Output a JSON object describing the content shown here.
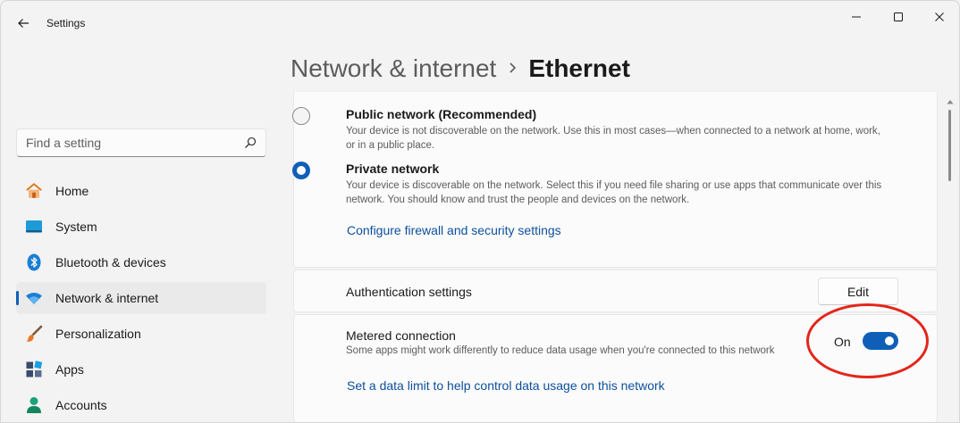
{
  "window": {
    "app_title": "Settings",
    "controls": {
      "minimize": "minimize-icon",
      "maximize": "maximize-icon",
      "close": "close-icon"
    }
  },
  "breadcrumb": {
    "parent": "Network & internet",
    "separator": "›",
    "current": "Ethernet"
  },
  "search": {
    "placeholder": "Find a setting"
  },
  "sidebar": {
    "items": [
      {
        "label": "Home",
        "icon": "home-icon",
        "active": false
      },
      {
        "label": "System",
        "icon": "system-icon",
        "active": false
      },
      {
        "label": "Bluetooth & devices",
        "icon": "bluetooth-icon",
        "active": false
      },
      {
        "label": "Network & internet",
        "icon": "wifi-icon",
        "active": true
      },
      {
        "label": "Personalization",
        "icon": "brush-icon",
        "active": false
      },
      {
        "label": "Apps",
        "icon": "apps-icon",
        "active": false
      },
      {
        "label": "Accounts",
        "icon": "account-icon",
        "active": false
      }
    ]
  },
  "network_profile": {
    "public": {
      "title": "Public network (Recommended)",
      "description": "Your device is not discoverable on the network. Use this in most cases—when connected to a network at home, work, or in a public place.",
      "selected": false
    },
    "private": {
      "title": "Private network",
      "description": "Your device is discoverable on the network. Select this if you need file sharing or use apps that communicate over this network. You should know and trust the people and devices on the network.",
      "selected": true
    },
    "firewall_link": "Configure firewall and security settings"
  },
  "authentication": {
    "label": "Authentication settings",
    "button": "Edit"
  },
  "metered": {
    "label": "Metered connection",
    "description": "Some apps might work differently to reduce data usage when you're connected to this network",
    "state_label": "On",
    "enabled": true,
    "data_limit_link": "Set a data limit to help control data usage on this network"
  },
  "colors": {
    "accent": "#0f5fb8",
    "link": "#0d4f9e",
    "annotation": "#e3261b",
    "background": "#f3f3f3",
    "card": "#fbfbfb"
  }
}
